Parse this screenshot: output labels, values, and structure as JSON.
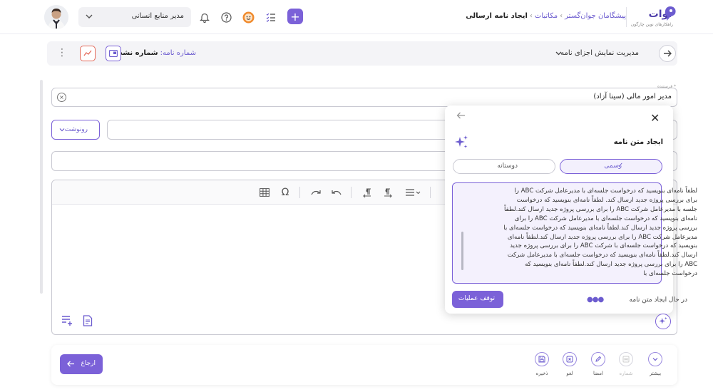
{
  "header": {
    "role_select": "مدیر منابع انسانی",
    "breadcrumb": [
      "پیشگامان جوان‌گستر",
      "مکاتبات",
      "ایجاد نامه ارسالی"
    ],
    "brand_name": "آوات",
    "brand_tagline": "راهکارهای نوین چارگون",
    "icons": [
      "bell-icon",
      "help-icon",
      "emoji-icon",
      "tasks-icon",
      "plus-icon"
    ]
  },
  "subbar": {
    "display_select": "مدیریت نمایش اجزای نامه",
    "letter_number_label": "شماره نامه:",
    "letter_number_value": "شماره نشده"
  },
  "form": {
    "sender_label": "فرستنده *",
    "sender_value": "مدیر امور مالی (سینا آزاد)",
    "copy_button": "رونوشت"
  },
  "editor": {
    "toolbar_icons": [
      "table-icon",
      "omega-icon",
      "redo-icon",
      "undo-icon",
      "rtl-icon",
      "ltr-icon",
      "align-icon"
    ]
  },
  "ai_panel": {
    "title": "ایجاد متن نامه",
    "tones": [
      "رسمی",
      "دوستانه"
    ],
    "selected_tone": "رسمی",
    "generated_text": "لطفاً نامه‌ای بنویسید که درخواست جلسه‌ای با مدیرعامل شرکت ABC را برای بررسی پروژه جدید ارسال کند. لطفاً نامه‌ای بنویسید که درخواست جلسه  با مدیرعامل شرکت ABC را برای بررسی پروژه جدید ارسال کند.لطفاً نامه‌ای بنویسید که درخواست جلسه‌ای  با مدیرعامل شرکت ABC را برای بررسی پروژه جدید ارسال کند.لطفاً نامه‌ای بنویسید که درخواست جلسه‌ای  با مدیرعامل شرکت ABC را برای بررسی پروژه جدید ارسال کند.لطفاً نامه‌ای بنویسید که درخواست جلسه‌ای  با شرکت ABC را برای بررسی پروژه جدید ارسال کند.لطفاً نامه‌ای بنویسید که درخواست جلسه‌ای  با مدیرعامل شرکت ABC را برای بررسی پروژه جدید ارسال کند.لطفاً نامه‌ای بنویسید که درخواست جلسه‌ای  با",
    "status": "در حال ایجاد متن نامه",
    "stop_button": "توقف عملیات"
  },
  "footer": {
    "return_button": "ارجاع",
    "actions": [
      {
        "label": "بیشتر",
        "icon": "chevron-down-icon",
        "enabled": true
      },
      {
        "label": "شماره",
        "icon": "number-icon",
        "enabled": false
      },
      {
        "label": "امضا",
        "icon": "pen-icon",
        "enabled": true
      },
      {
        "label": "لغو",
        "icon": "cancel-icon",
        "enabled": true
      },
      {
        "label": "ذخیره",
        "icon": "save-icon",
        "enabled": true
      }
    ]
  },
  "colors": {
    "accent": "#7b61d8",
    "accent_light": "#f3f0fd",
    "danger": "#e46a5a"
  }
}
